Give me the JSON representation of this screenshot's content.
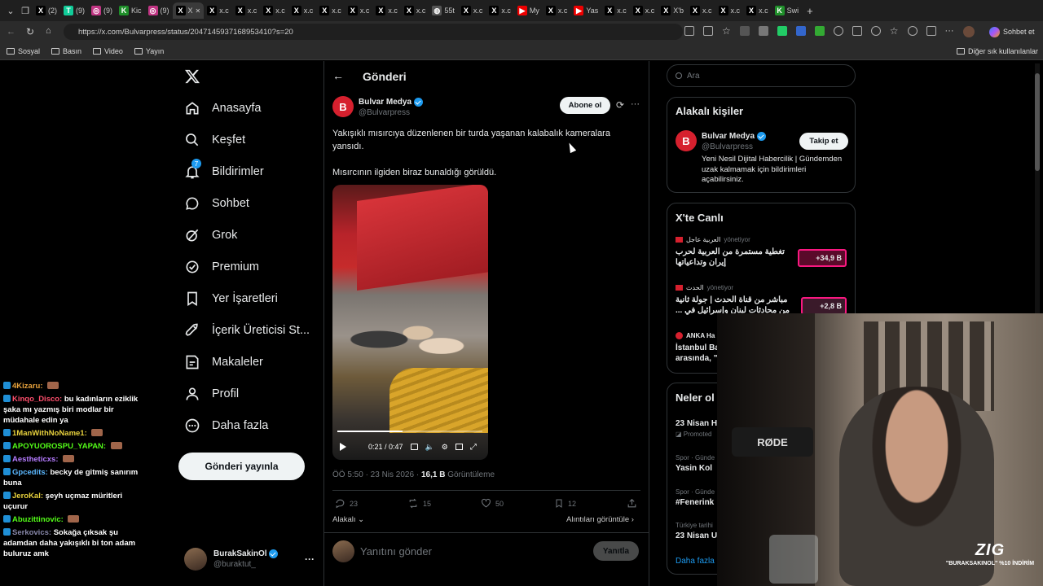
{
  "browser": {
    "tabs": [
      {
        "label": "(2)",
        "icon": "x",
        "color": "#000"
      },
      {
        "label": "(9)",
        "icon": "tradingview",
        "color": "#1c9"
      },
      {
        "label": "(9)",
        "icon": "instagram",
        "color": "#c13584"
      },
      {
        "label": "Kic",
        "icon": "kick",
        "color": "#53fc18"
      },
      {
        "label": "(9)",
        "icon": "instagram",
        "color": "#c13584"
      },
      {
        "label": "X",
        "icon": "x",
        "color": "#000",
        "active": true
      },
      {
        "label": "x.c",
        "icon": "x"
      },
      {
        "label": "x.c",
        "icon": "x"
      },
      {
        "label": "x.c",
        "icon": "x"
      },
      {
        "label": "x.c",
        "icon": "x"
      },
      {
        "label": "x.c",
        "icon": "x"
      },
      {
        "label": "x.c",
        "icon": "x"
      },
      {
        "label": "x.c",
        "icon": "x"
      },
      {
        "label": "x.c",
        "icon": "x"
      },
      {
        "label": "55t",
        "icon": "globe"
      },
      {
        "label": "x.c",
        "icon": "x"
      },
      {
        "label": "x.c",
        "icon": "x"
      },
      {
        "label": "My",
        "icon": "youtube"
      },
      {
        "label": "x.c",
        "icon": "x"
      },
      {
        "label": "Yas",
        "icon": "youtube"
      },
      {
        "label": "x.c",
        "icon": "x"
      },
      {
        "label": "x.c",
        "icon": "x"
      },
      {
        "label": "X'b",
        "icon": "x"
      },
      {
        "label": "x.c",
        "icon": "x"
      },
      {
        "label": "x.c",
        "icon": "x"
      },
      {
        "label": "x.c",
        "icon": "x"
      },
      {
        "label": "Swi",
        "icon": "kick"
      }
    ],
    "url": "https://x.com/Bulvarpress/status/2047145937168953410?s=20",
    "bookmarks": [
      "Sosyal",
      "Basın",
      "Video",
      "Yayın"
    ],
    "other_bookmarks": "Diğer sık kullanılanlar",
    "copilot_label": "Sohbet et"
  },
  "nav": {
    "items": [
      "Anasayfa",
      "Keşfet",
      "Bildirimler",
      "Sohbet",
      "Grok",
      "Premium",
      "Yer İşaretleri",
      "İçerik Üreticisi St...",
      "Makaleler",
      "Profil",
      "Daha fazla"
    ],
    "notif_count": "7",
    "post_button": "Gönderi yayınla",
    "account_name": "BurakSakinOl",
    "account_handle": "@buraktut_"
  },
  "post": {
    "header": "Gönderi",
    "author": "Bulvar Medya",
    "handle": "@Bulvarpress",
    "subscribe": "Abone ol",
    "text1": "Yakışıklı mısırcıya düzenlenen bir turda yaşanan kalabalık kameralara yansıdı.",
    "text2": "Mısırcının ilgiden biraz bunaldığı görüldü.",
    "video_time": "0:21 / 0:47",
    "video_progress": 0.45,
    "timestamp": "ÖÖ 5:50 · 23 Nis 2026 · ",
    "views": "16,1 B",
    "views_label": "Görüntüleme",
    "replies": "23",
    "reposts": "15",
    "likes": "50",
    "bookmarks": "12",
    "related": "Alakalı",
    "quotes": "Alıntıları görüntüle",
    "reply_placeholder": "Yanıtını gönder",
    "reply_button": "Yanıtla"
  },
  "sidebar": {
    "search_placeholder": "Ara",
    "related_title": "Alakalı kişiler",
    "related_name": "Bulvar Medya",
    "related_handle": "@Bulvarpress",
    "related_bio": "Yeni Nesil Dijital Habercilik | Gündemden uzak kalmamak için bildirimleri açabilirsiniz.",
    "follow_button": "Takip et",
    "live_title": "X'te Canlı",
    "live": [
      {
        "source": "العربية عاجل",
        "role": "yönetiyor",
        "text": "تغطية مستمرة من العربية لحرب إيران وتداعياتها",
        "count": "+34,9 B"
      },
      {
        "source": "الحدث",
        "role": "yönetiyor",
        "text": "مباشر من قناة الحدث | جولة ثانية من محادثات لبنان وإسرائيل في ...",
        "count": "+2,8 B"
      },
      {
        "source": "ANKA Ha",
        "role": "",
        "text": "İstanbul Ba arasında, \"",
        "count": ""
      }
    ],
    "trends_title": "Neler ol",
    "trends": [
      {
        "meta": "",
        "title": "23 Nisan H",
        "sub": "Promoted"
      },
      {
        "meta": "Spor · Günde",
        "title": "Yasin Kol",
        "sub": ""
      },
      {
        "meta": "Spor · Günde",
        "title": "#Fenerink",
        "sub": ""
      },
      {
        "meta": "Türkiye tarihi",
        "title": "23 Nisan Ulusal Egemenlik",
        "sub": ""
      }
    ],
    "show_more": "Daha fazla göster"
  },
  "chat": [
    {
      "user": "4Kizaru:",
      "msg": "",
      "color": "#e8a33d"
    },
    {
      "user": "Kinqo_Disco:",
      "msg": "bu kadınların eziklik şaka mı yazmış biri modlar bir müdahale edin ya",
      "color": "#ff4f6d"
    },
    {
      "user": "1ManWithNoName1:",
      "msg": "",
      "color": "#e8d23d"
    },
    {
      "user": "APOYUOROSPU_YAPAN:",
      "msg": "",
      "color": "#53fc18"
    },
    {
      "user": "Aestheticxs:",
      "msg": "",
      "color": "#b57bff"
    },
    {
      "user": "Gpcedits:",
      "msg": "becky de gitmiş sanırım buna",
      "color": "#5bb8ff"
    },
    {
      "user": "JeroKal:",
      "msg": "şeyh uçmaz müritleri uçurur",
      "color": "#e8d23d"
    },
    {
      "user": "Abuzittinovic:",
      "msg": "",
      "color": "#53fc18"
    },
    {
      "user": "Serkovics:",
      "msg": "Sokağa çıksak şu adamdan daha yakışıklı bi ton adam buluruz amk",
      "color": "#8888aa"
    }
  ],
  "overlay": {
    "logo": "ZIG",
    "promo": "\"BURAKSAKINOL\" %10 İNDİRİM",
    "mic_brand": "RØDE"
  }
}
